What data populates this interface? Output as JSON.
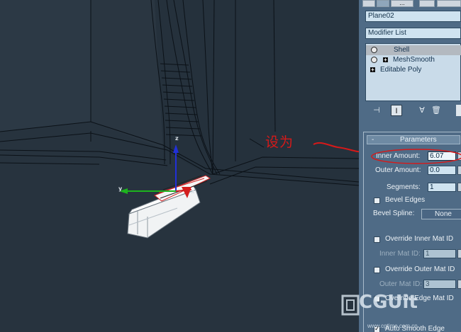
{
  "annotation": {
    "text": "设为",
    "color": "#d71919"
  },
  "viewport": {
    "gizmo_axes": {
      "x": "x",
      "y": "y",
      "z": "z"
    },
    "colors": {
      "background": "#27333e",
      "wire": "#0a0f14",
      "gizmo_x": "#d41e1e",
      "gizmo_y": "#1db41d",
      "gizmo_z": "#2130d8"
    }
  },
  "panel": {
    "top_toolbar": {
      "icons": [
        "hierarchy-tab-icon",
        "motion-tab-icon",
        "display-tab-icon",
        "utilities-tab-icon",
        "create-tab-icon"
      ],
      "more_label": "..."
    },
    "object_name": "Plane02",
    "modifier_list_label": "Modifier List",
    "modifier_stack": [
      {
        "label": "Shell",
        "selected": true,
        "light_icon": true,
        "expand_icon": false
      },
      {
        "label": "MeshSmooth",
        "selected": false,
        "light_icon": true,
        "expand_icon": true
      },
      {
        "label": "Editable Poly",
        "selected": false,
        "light_icon": false,
        "expand_icon": true
      }
    ],
    "stack_tools": [
      "pin-stack-icon",
      "show-end-result-icon",
      "make-unique-icon",
      "remove-modifier-icon",
      "configure-sets-icon"
    ],
    "parameters": {
      "header_minus": "-",
      "header_title": "Parameters",
      "inner_amount_label": "Inner Amount:",
      "inner_amount_value": "6.07",
      "outer_amount_label": "Outer Amount:",
      "outer_amount_value": "0.0",
      "segments_label": "Segments:",
      "segments_value": "1",
      "bevel_edges_label": "Bevel Edges",
      "bevel_edges_checked": false,
      "bevel_spline_label": "Bevel Spline:",
      "bevel_spline_button": "None",
      "override_inner_label": "Override Inner Mat ID",
      "override_inner_checked": false,
      "inner_mat_id_label": "Inner Mat ID:",
      "inner_mat_id_value": "1",
      "override_outer_label": "Override Outer Mat ID",
      "override_outer_checked": false,
      "outer_mat_id_label": "Outer Mat ID:",
      "outer_mat_id_value": "3",
      "override_edge_label": "Override Edge Mat ID",
      "override_edge_checked": false,
      "auto_smooth_label": "Auto Smooth Edge",
      "auto_smooth_checked": true
    },
    "colors": {
      "panel_bg": "#4f6b86",
      "field_bg": "#cfe3f0"
    }
  },
  "watermark": {
    "logo_text": "CGUit",
    "url": "www.cgtime.com.cn"
  }
}
